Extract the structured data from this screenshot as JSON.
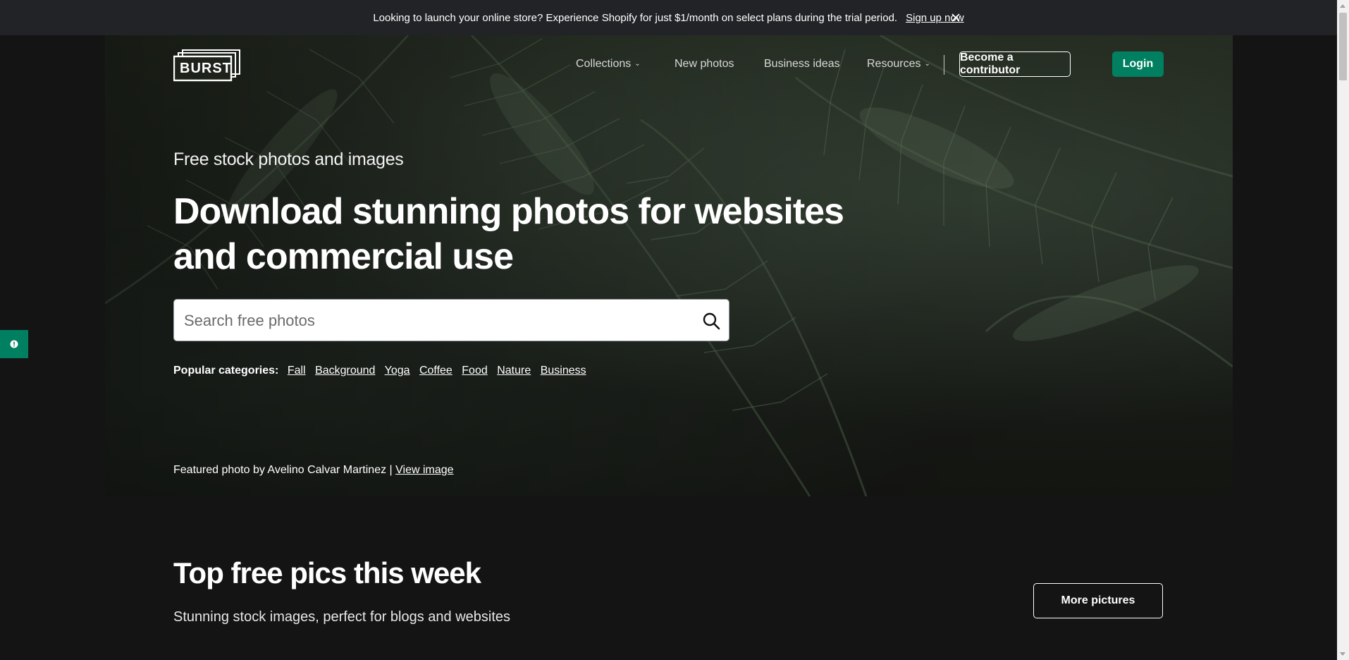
{
  "announcement": {
    "message": "Looking to launch your online store? Experience Shopify for just $1/month on select plans during the trial period.",
    "link_label": "Sign up now"
  },
  "brand": {
    "logo_text": "BURST"
  },
  "nav": {
    "items": [
      {
        "label": "Collections",
        "has_dropdown": true
      },
      {
        "label": "New photos",
        "has_dropdown": false
      },
      {
        "label": "Business ideas",
        "has_dropdown": false
      },
      {
        "label": "Resources",
        "has_dropdown": true
      }
    ],
    "contributor_label": "Become a contributor",
    "login_label": "Login"
  },
  "hero": {
    "subtitle": "Free stock photos and images",
    "headline": "Download stunning photos for websites and commercial use",
    "search_placeholder": "Search free photos",
    "popular_label": "Popular categories:",
    "categories": [
      "Fall",
      "Background",
      "Yoga",
      "Coffee",
      "Food",
      "Nature",
      "Business"
    ],
    "featured_text": "Featured photo by Avelino Calvar Martinez |",
    "featured_link": "View image"
  },
  "top_section": {
    "title": "Top free pics this week",
    "subtitle": "Stunning stock images, perfect for blogs and websites",
    "more_label": "More pictures"
  },
  "colors": {
    "brand_green": "#008060",
    "page_bg": "#141414",
    "announcement_bg": "#212326"
  }
}
